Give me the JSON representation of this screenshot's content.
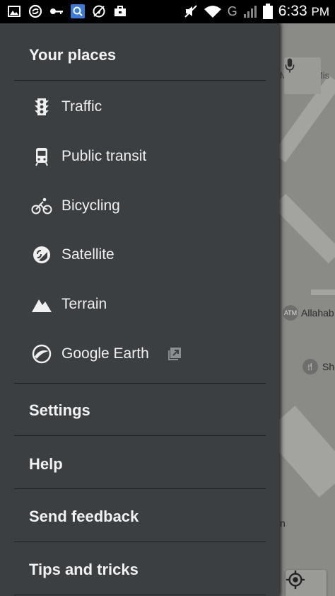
{
  "status_bar": {
    "time": "6:33",
    "time_suffix": "PM",
    "left_icons": [
      "gallery-icon",
      "sync-icon",
      "key-icon",
      "search-app-icon",
      "no-location-icon",
      "briefcase-icon"
    ],
    "right_icons": [
      "mute-icon",
      "wifi-icon",
      "signal-icon",
      "battery-icon"
    ],
    "network_label": "G"
  },
  "map": {
    "labels": {
      "street": "Mahesh Mis",
      "atm_badge": "ATM",
      "place": "Allahab",
      "restaurant": "Sh",
      "edge_letter": "n"
    }
  },
  "drawer": {
    "header": "Your places",
    "layers": [
      {
        "label": "Traffic",
        "icon": "traffic-light-icon"
      },
      {
        "label": "Public transit",
        "icon": "train-icon"
      },
      {
        "label": "Bicycling",
        "icon": "bicycle-icon"
      },
      {
        "label": "Satellite",
        "icon": "satellite-icon"
      },
      {
        "label": "Terrain",
        "icon": "mountain-icon"
      },
      {
        "label": "Google Earth",
        "icon": "google-earth-icon",
        "external": "open-external-icon"
      }
    ],
    "links": [
      "Settings",
      "Help",
      "Send feedback",
      "Tips and tricks"
    ]
  },
  "colors": {
    "drawer_bg": "#3b3f42",
    "divider": "#1f2224",
    "text": "#f0f0f0",
    "map_bg": "#8a8a87"
  }
}
